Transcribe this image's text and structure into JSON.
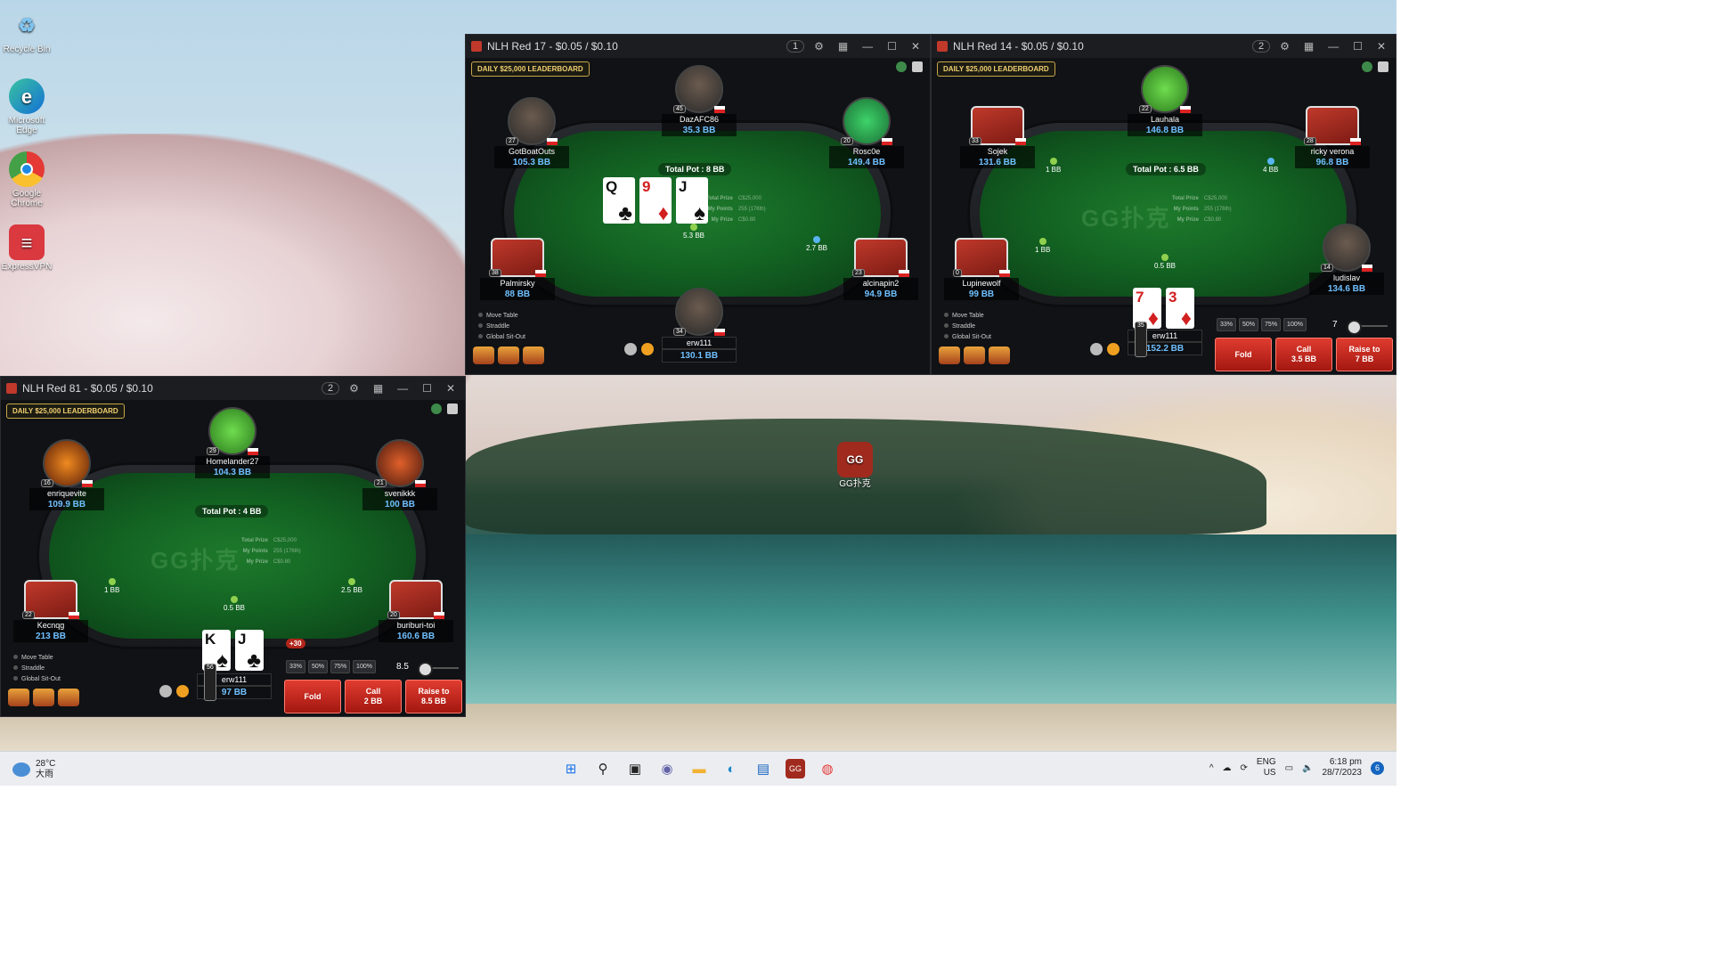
{
  "desktop": {
    "icons": [
      {
        "label": "Recycle Bin"
      },
      {
        "label": "Microsoft Edge"
      },
      {
        "label": "Google Chrome"
      },
      {
        "label": "ExpressVPN"
      }
    ],
    "gg_icon_label": "GG扑克"
  },
  "tables": [
    {
      "title": "NLH Red 17 - $0.05 / $0.10",
      "observers": "1",
      "leaderboard": "DAILY $25,000 LEADERBOARD",
      "pot": "Total Pot : 8 BB",
      "info": {
        "total_prize_label": "Total Prize",
        "total_prize": "C$25,000",
        "my_points_label": "My Points",
        "my_points": "255 (176th)",
        "my_prize_label": "My Prize",
        "my_prize": "C$0.80"
      },
      "board": [
        {
          "rank": "Q",
          "suit": "♣",
          "color": "blk"
        },
        {
          "rank": "9",
          "suit": "♦",
          "color": "red"
        },
        {
          "rank": "J",
          "suit": "♠",
          "color": "blk"
        }
      ],
      "seats": [
        {
          "name": "DazAFC86",
          "stack": "35.3 BB",
          "level": "45"
        },
        {
          "name": "GotBoatOuts",
          "stack": "105.3 BB",
          "level": "27"
        },
        {
          "name": "Rosc0e",
          "stack": "149.4 BB",
          "level": "20"
        },
        {
          "name": "Palmirsky",
          "stack": "88 BB",
          "level": "38"
        },
        {
          "name": "alcinapin2",
          "stack": "94.9 BB",
          "level": "23"
        },
        {
          "name": "erw111",
          "stack": "130.1 BB",
          "level": "34"
        }
      ],
      "bets": [
        "5.3 BB",
        "2.7 BB"
      ],
      "options": [
        "Move Table",
        "Straddle",
        "Global Sit-Out"
      ]
    },
    {
      "title": "NLH Red 14 - $0.05 / $0.10",
      "observers": "2",
      "leaderboard": "DAILY $25,000 LEADERBOARD",
      "pot": "Total Pot : 6.5 BB",
      "logo_text": "GG扑克",
      "info": {
        "total_prize_label": "Total Prize",
        "total_prize": "C$25,000",
        "my_points_label": "My Points",
        "my_points": "255 (176th)",
        "my_prize_label": "My Prize",
        "my_prize": "C$0.80"
      },
      "seats": [
        {
          "name": "Lauhala",
          "stack": "146.8 BB",
          "level": "22"
        },
        {
          "name": "Sojek",
          "stack": "131.6 BB",
          "level": "33"
        },
        {
          "name": "ricky verona",
          "stack": "96.8 BB",
          "level": "28"
        },
        {
          "name": "Lupinewolf",
          "stack": "99 BB",
          "level": "0"
        },
        {
          "name": "ludislav",
          "stack": "134.6 BB",
          "level": "14"
        },
        {
          "name": "erw111",
          "stack": "152.2 BB",
          "level": "35"
        }
      ],
      "hero_cards": [
        {
          "rank": "7",
          "suit": "♦",
          "color": "red"
        },
        {
          "rank": "3",
          "suit": "♦",
          "color": "red"
        }
      ],
      "bets": [
        "1 BB",
        "4 BB",
        "1 BB",
        "0.5 BB"
      ],
      "pct": [
        "33%",
        "50%",
        "75%",
        "100%"
      ],
      "bet_value": "7",
      "buttons": {
        "fold": "Fold",
        "call": "Call\n3.5 BB",
        "raise": "Raise to\n7 BB"
      },
      "options": [
        "Move Table",
        "Straddle",
        "Global Sit-Out"
      ]
    },
    {
      "title": "NLH Red 81 - $0.05 / $0.10",
      "observers": "2",
      "leaderboard": "DAILY $25,000 LEADERBOARD",
      "pot": "Total Pot : 4 BB",
      "logo_text": "GG扑克",
      "info": {
        "total_prize_label": "Total Prize",
        "total_prize": "C$25,000",
        "my_points_label": "My Points",
        "my_points": "255 (176th)",
        "my_prize_label": "My Prize",
        "my_prize": "C$0.80"
      },
      "seats": [
        {
          "name": "Homelander27",
          "stack": "104.3 BB",
          "level": "29"
        },
        {
          "name": "enriquevite",
          "stack": "109.9 BB",
          "level": "16"
        },
        {
          "name": "svenikkk",
          "stack": "100 BB",
          "level": "21"
        },
        {
          "name": "Kecnqg",
          "stack": "213 BB",
          "level": "22"
        },
        {
          "name": "buriburi-toi",
          "stack": "160.6 BB",
          "level": "20"
        },
        {
          "name": "erw111",
          "stack": "97 BB",
          "level": "56"
        }
      ],
      "hero_cards": [
        {
          "rank": "K",
          "suit": "♠",
          "color": "blk"
        },
        {
          "rank": "J",
          "suit": "♣",
          "color": "blk"
        }
      ],
      "bets": [
        "1 BB",
        "0.5 BB",
        "2.5 BB"
      ],
      "time_bank": "+30",
      "pct": [
        "33%",
        "50%",
        "75%",
        "100%"
      ],
      "bet_value": "8.5",
      "buttons": {
        "fold": "Fold",
        "call": "Call\n2 BB",
        "raise": "Raise to\n8.5 BB"
      },
      "options": [
        "Move Table",
        "Straddle",
        "Global Sit-Out"
      ]
    }
  ],
  "taskbar": {
    "temperature": "28°C",
    "weather": "大雨",
    "lang": "ENG",
    "region": "US",
    "time": "6:18 pm",
    "date": "28/7/2023",
    "notifications": "6"
  }
}
